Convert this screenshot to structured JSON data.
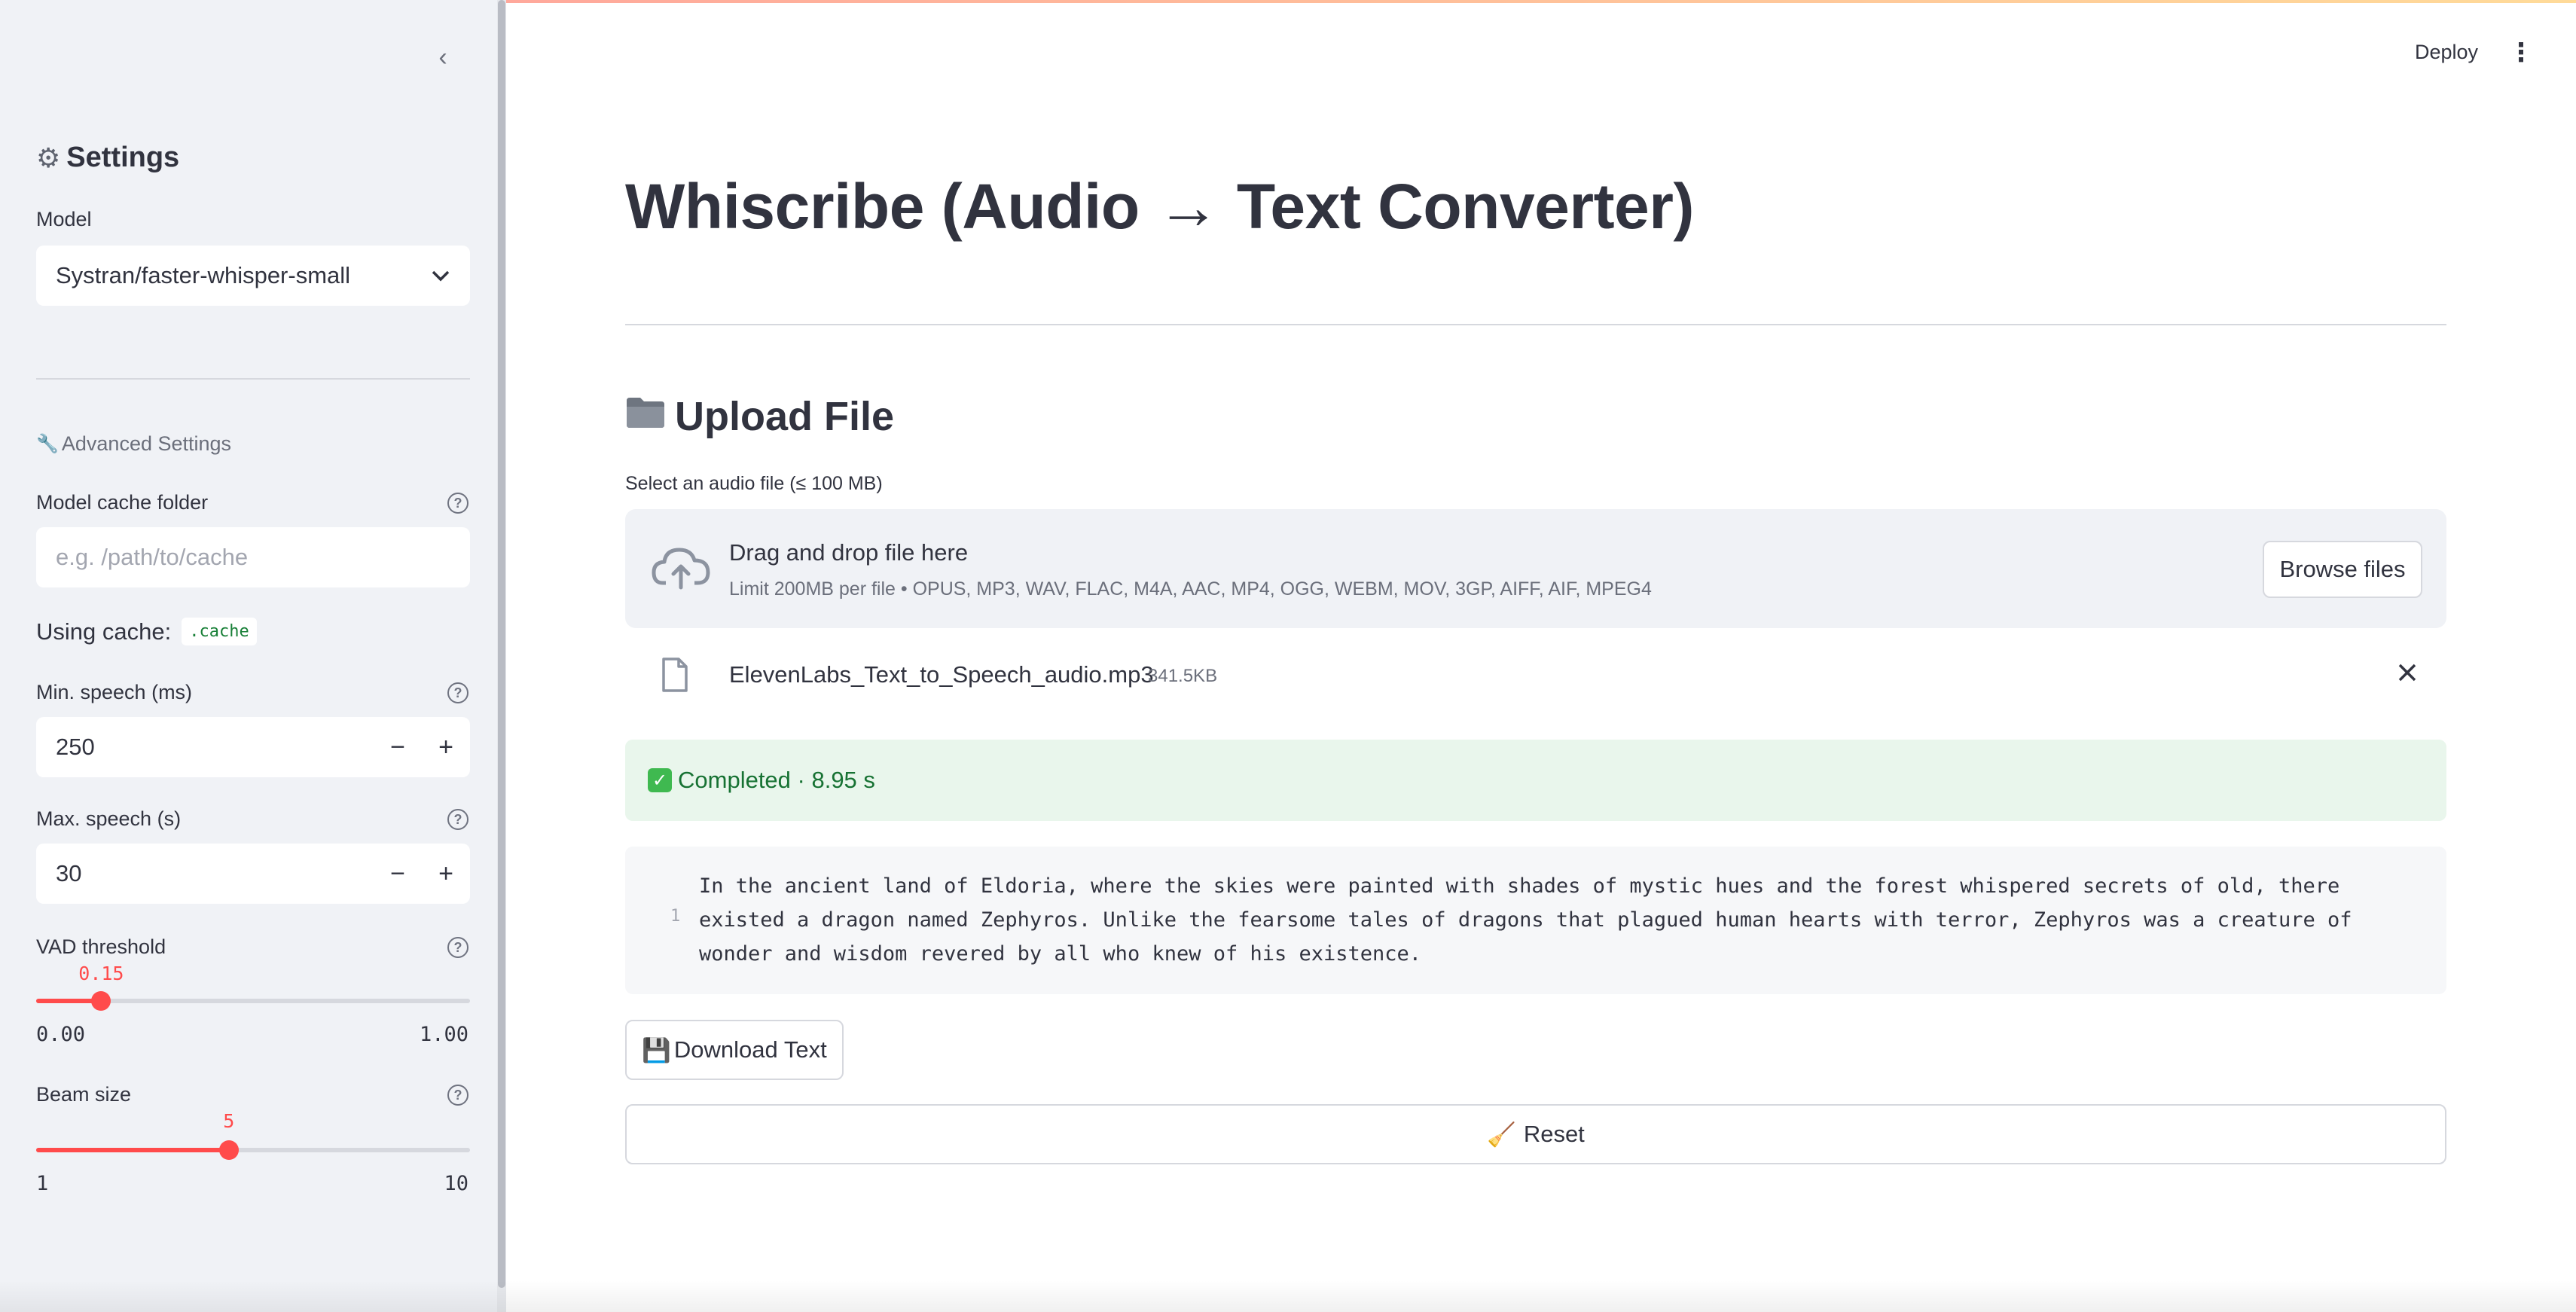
{
  "header": {
    "deploy_label": "Deploy",
    "menu_icon": "kebab-menu-icon"
  },
  "sidebar": {
    "collapse_icon": "chevron-left-icon",
    "title": "Settings",
    "title_icon": "gear-icon",
    "model": {
      "label": "Model",
      "value": "Systran/faster-whisper-small"
    },
    "advanced_label": "Advanced Settings",
    "advanced_icon": "wrench-icon",
    "cache_folder": {
      "label": "Model cache folder",
      "placeholder": "e.g. /path/to/cache"
    },
    "using_cache": {
      "label": "Using cache:",
      "value": ".cache"
    },
    "min_speech": {
      "label": "Min. speech (ms)",
      "value": "250"
    },
    "max_speech": {
      "label": "Max. speech (s)",
      "value": "30"
    },
    "vad": {
      "label": "VAD threshold",
      "value": "0.15",
      "min": "0.00",
      "max": "1.00",
      "fraction": 0.15
    },
    "beam": {
      "label": "Beam size",
      "value": "5",
      "min": "1",
      "max": "10",
      "fraction": 0.444
    }
  },
  "main": {
    "title": "Whiscribe (Audio → Text Converter)",
    "upload_heading": "Upload File",
    "upload_icon": "folder-icon",
    "upload_label": "Select an audio file (≤ 100 MB)",
    "dropzone": {
      "title": "Drag and drop file here",
      "subtitle": "Limit 200MB per file • OPUS, MP3, WAV, FLAC, M4A, AAC, MP4, OGG, WEBM, MOV, 3GP, AIFF, AIF, MPEG4",
      "browse_label": "Browse files",
      "icon": "cloud-upload-icon"
    },
    "file": {
      "name": "ElevenLabs_Text_to_Speech_audio.mp3",
      "size": "341.5KB",
      "icon": "file-icon",
      "remove_icon": "close-icon"
    },
    "status": {
      "text": "Completed · 8.95 s",
      "icon": "check-icon"
    },
    "transcript": {
      "line_number": "1",
      "text": "In the ancient land of Eldoria, where the skies were painted with shades of mystic hues and the forest whispered secrets of old, there existed a dragon named Zephyros. Unlike the fearsome tales of dragons that plagued human hearts with terror, Zephyros was a creature of wonder and wisdom revered by all who knew of his existence."
    },
    "download_label": "Download Text",
    "download_icon": "floppy-disk-icon",
    "reset_label": "Reset",
    "reset_icon": "broom-icon"
  },
  "colors": {
    "accent": "#ff4b4b",
    "sidebar_bg": "#f0f2f6",
    "success_bg": "#e9f6ec",
    "success_text": "#177233"
  }
}
